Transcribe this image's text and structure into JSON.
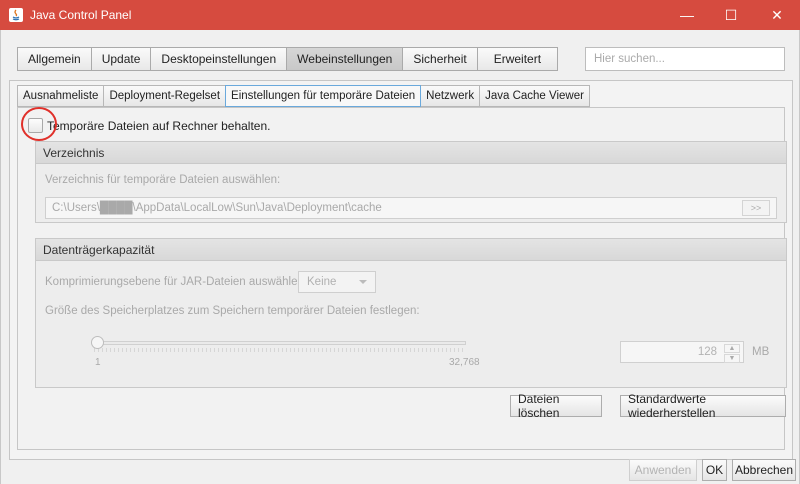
{
  "window": {
    "title": "Java Control Panel",
    "minimize_symbol": "—",
    "maximize_symbol": "☐",
    "close_symbol": "✕"
  },
  "main_tabs": [
    {
      "label": "Allgemein"
    },
    {
      "label": "Update"
    },
    {
      "label": "Desktopeinstellungen"
    },
    {
      "label": "Webeinstellungen",
      "active": true
    },
    {
      "label": "Sicherheit"
    },
    {
      "label": "Erweitert"
    }
  ],
  "search": {
    "placeholder": "Hier suchen..."
  },
  "sub_tabs": [
    {
      "label": "Ausnahmeliste"
    },
    {
      "label": "Deployment-Regelset"
    },
    {
      "label": "Einstellungen für temporäre Dateien",
      "active": true
    },
    {
      "label": "Netzwerk"
    },
    {
      "label": "Java Cache Viewer"
    }
  ],
  "temp_files": {
    "keep_checkbox_label": "Temporäre Dateien auf Rechner behalten.",
    "keep_checked": false,
    "directory_group": {
      "title": "Verzeichnis",
      "instruction": "Verzeichnis für temporäre Dateien auswählen:",
      "path": "C:\\Users\\████\\AppData\\LocalLow\\Sun\\Java\\Deployment\\cache",
      "browse_label": ">>"
    },
    "capacity_group": {
      "title": "Datenträgerkapazität",
      "compression_label": "Komprimierungsebene für JAR-Dateien auswählen:",
      "compression_value": "Keine",
      "size_label": "Größe des Speicherplatzes zum Speichern temporärer Dateien festlegen:",
      "slider_min_label": "1",
      "slider_max_label": "32,768",
      "slider_value": 1,
      "size_value": "128",
      "size_unit": "MB"
    },
    "delete_button": "Dateien löschen",
    "restore_button": "Standardwerte wiederherstellen"
  },
  "footer": {
    "apply": "Anwenden",
    "ok": "OK",
    "cancel": "Abbrechen"
  },
  "colors": {
    "titlebar": "#d64b3f",
    "annotation_circle": "#e0302a",
    "active_subtab_border": "#6aa9dc"
  }
}
